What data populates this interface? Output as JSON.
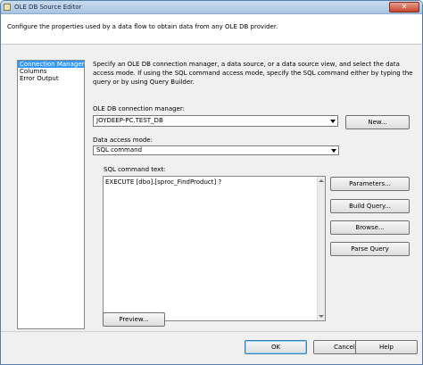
{
  "window": {
    "title": "OLE DB Source Editor",
    "close_glyph": "✕"
  },
  "header": {
    "text": "Configure the properties used by a data flow to obtain data from any OLE DB provider."
  },
  "sidebar": {
    "items": [
      {
        "label": "Connection Manager",
        "selected": true
      },
      {
        "label": "Columns",
        "selected": false
      },
      {
        "label": "Error Output",
        "selected": false
      }
    ]
  },
  "main": {
    "description": "Specify an OLE DB connection manager, a data source, or a data source view, and select the data access mode. If using the SQL command access mode, specify the SQL command either by typing the query or by using Query Builder.",
    "connection_label": "OLE DB connection manager:",
    "connection_value": "JOYDEEP-PC.TEST_DB",
    "new_button": "New...",
    "access_mode_label": "Data access mode:",
    "access_mode_value": "SQL command",
    "sql_label": "SQL command text:",
    "sql_text": "EXECUTE [dbo].[sproc_FindProduct] ?",
    "side_buttons": [
      "Parameters...",
      "Build Query...",
      "Browse...",
      "Parse Query"
    ],
    "preview_button": "Preview..."
  },
  "footer": {
    "ok": "OK",
    "cancel": "Cancel",
    "help": "Help"
  },
  "icons": {
    "app": "ssis-component-icon",
    "close": "close-icon"
  },
  "colors": {
    "selection": "#3399ff",
    "title_gradient_top": "#c9dcef",
    "close_red": "#c7462f"
  }
}
